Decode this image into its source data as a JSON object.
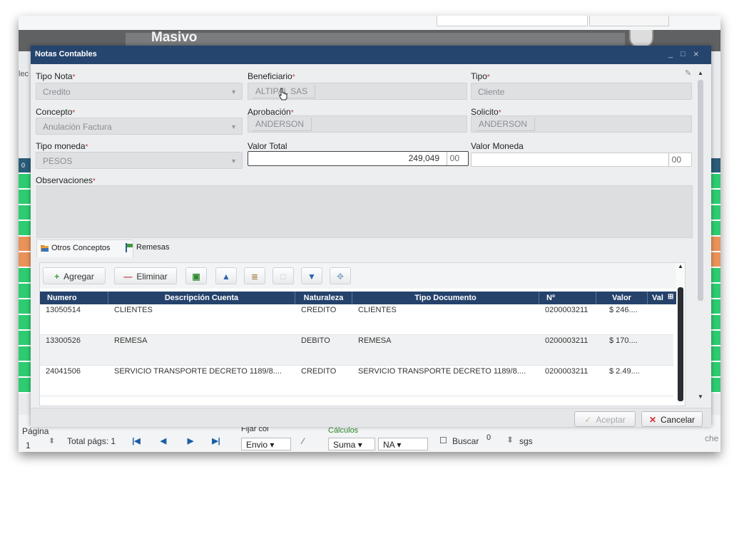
{
  "background": {
    "title": "Masivo",
    "left_partial_text": "lec",
    "left_row_prefix": "0",
    "right_partial_text": "che",
    "bottom": {
      "pagina_label": "Página",
      "page_number": "1",
      "total_pages_label": "Total págs: 1",
      "fijar_label": "Fijar col",
      "envio_value": "Envio",
      "calculos_label": "Cálculos",
      "suma_value": "Suma",
      "na_value": "NA",
      "buscar_label": "Buscar",
      "buscar_count": "0",
      "sgs_label": "sgs"
    },
    "colors": {
      "green": "#2ecc71",
      "orange": "#e8935a",
      "teal": "#2b5c78"
    }
  },
  "dialog": {
    "title": "Notas Contables",
    "controls": [
      "_",
      "□",
      "×"
    ],
    "fields": {
      "tipo_nota": {
        "label": "Tipo Nota",
        "value": "Credito"
      },
      "beneficiario": {
        "label": "Beneficiario",
        "value": "ALTIPAL SAS"
      },
      "tipo": {
        "label": "Tipo",
        "value": "Cliente"
      },
      "concepto": {
        "label": "Concepto",
        "value": "Anulación Factura"
      },
      "aprobacion": {
        "label": "Aprobación",
        "value": "ANDERSON"
      },
      "solicito": {
        "label": "Solicito",
        "value": "ANDERSON"
      },
      "tipo_moneda": {
        "label": "Tipo moneda",
        "value": "PESOS"
      },
      "valor_total": {
        "label": "Valor Total",
        "value": "249,049",
        "decimals": "00"
      },
      "valor_moneda": {
        "label": "Valor Moneda",
        "value": "",
        "decimals": "00"
      },
      "observaciones": {
        "label": "Observaciones",
        "value": ""
      }
    },
    "tabs": [
      {
        "label": "Otros Conceptos",
        "icon": "folder-icon",
        "active": true
      },
      {
        "label": "Remesas",
        "icon": "flag-icon",
        "active": false
      }
    ],
    "toolbar": {
      "add_label": "Agregar",
      "delete_label": "Eliminar"
    },
    "grid": {
      "columns": [
        "Numero",
        "Descripción Cuenta",
        "Naturaleza",
        "Tipo Documento",
        "Nº",
        "Valor",
        "Val"
      ],
      "rows": [
        {
          "numero": "13050514",
          "descripcion": "CLIENTES",
          "naturaleza": "CREDITO",
          "tipo_documento": "CLIENTES",
          "n": "0200003211",
          "valor": "$ 246...."
        },
        {
          "numero": "13300526",
          "descripcion": "REMESA",
          "naturaleza": "DEBITO",
          "tipo_documento": "REMESA",
          "n": "0200003211",
          "valor": "$ 170...."
        },
        {
          "numero": "24041506",
          "descripcion": "SERVICIO TRANSPORTE DECRETO 1189/8....",
          "naturaleza": "CREDITO",
          "tipo_documento": "SERVICIO TRANSPORTE DECRETO 1189/8....",
          "n": "0200003211",
          "valor": "$ 2.49...."
        }
      ]
    },
    "footer": {
      "accept_label": "Aceptar",
      "cancel_label": "Cancelar"
    },
    "colors": {
      "title_bar": "#26456e",
      "grid_header": "#25426b",
      "required": "#c83232"
    }
  }
}
